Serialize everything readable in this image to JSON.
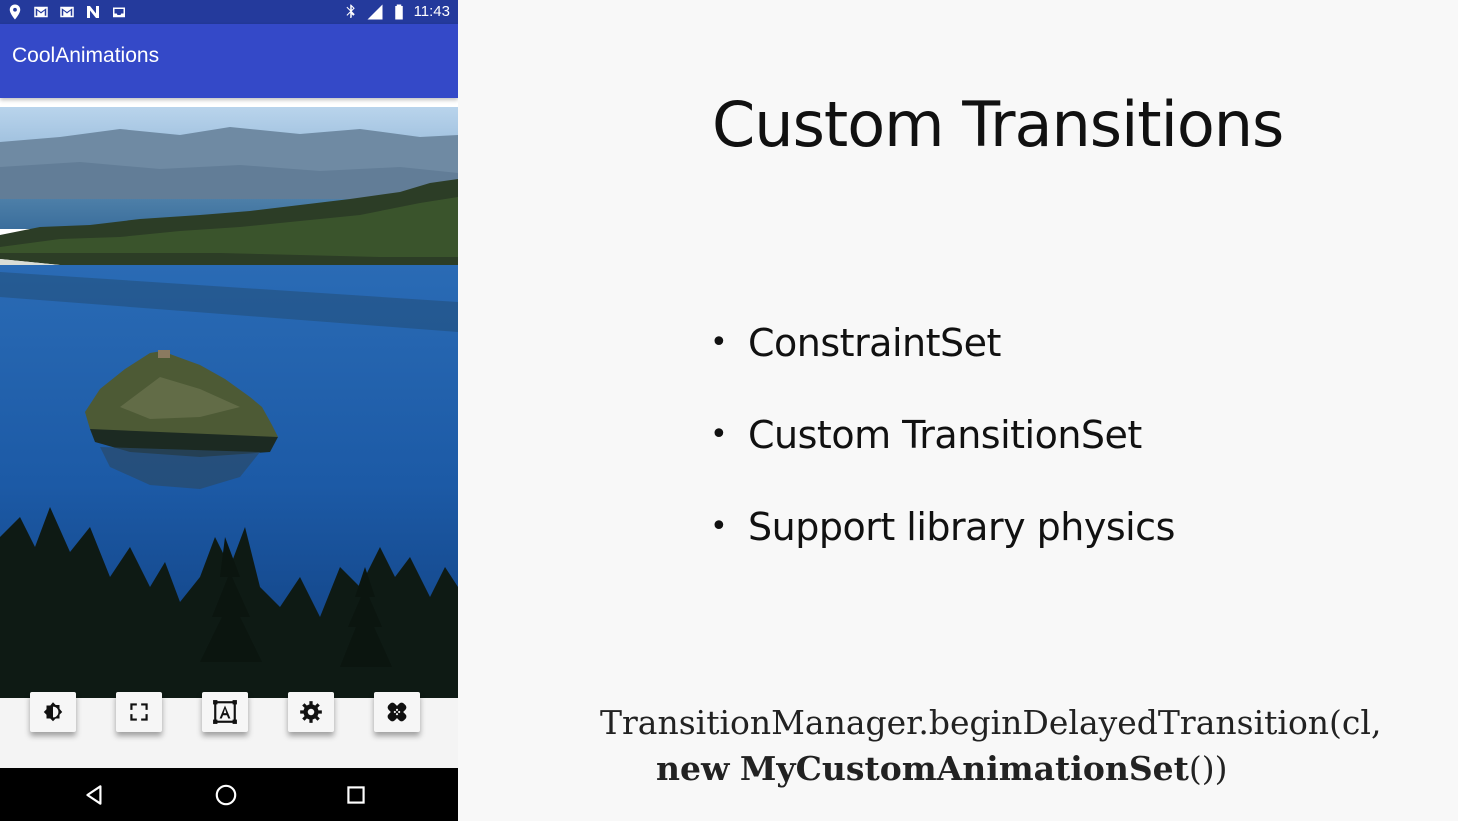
{
  "phone": {
    "status_bar": {
      "time": "11:43",
      "left_icons": [
        "location-pin-icon",
        "gmail-icon",
        "gmail-icon",
        "nfc-n-icon",
        "inbox-icon"
      ],
      "right_icons": [
        "bluetooth-icon",
        "lte-signal-icon",
        "battery-icon"
      ],
      "color": "#243a9c"
    },
    "app_bar": {
      "title": "CoolAnimations",
      "color": "#3449c8"
    },
    "toolbar": {
      "buttons": [
        "brightness-icon",
        "fullscreen-icon",
        "text-format-icon",
        "settings-icon",
        "healing-icon"
      ]
    },
    "nav_bar": {
      "buttons": [
        "back-icon",
        "home-icon",
        "recents-icon"
      ]
    }
  },
  "slide": {
    "title": "Custom Transitions",
    "bullets": [
      "ConstraintSet",
      "Custom TransitionSet",
      "Support library physics"
    ],
    "code": {
      "line1": "TransitionManager.beginDelayedTransition(cl,",
      "line2_keyword": "new",
      "line2_class": "MyCustomAnimationSet",
      "line2_end": "())"
    }
  }
}
